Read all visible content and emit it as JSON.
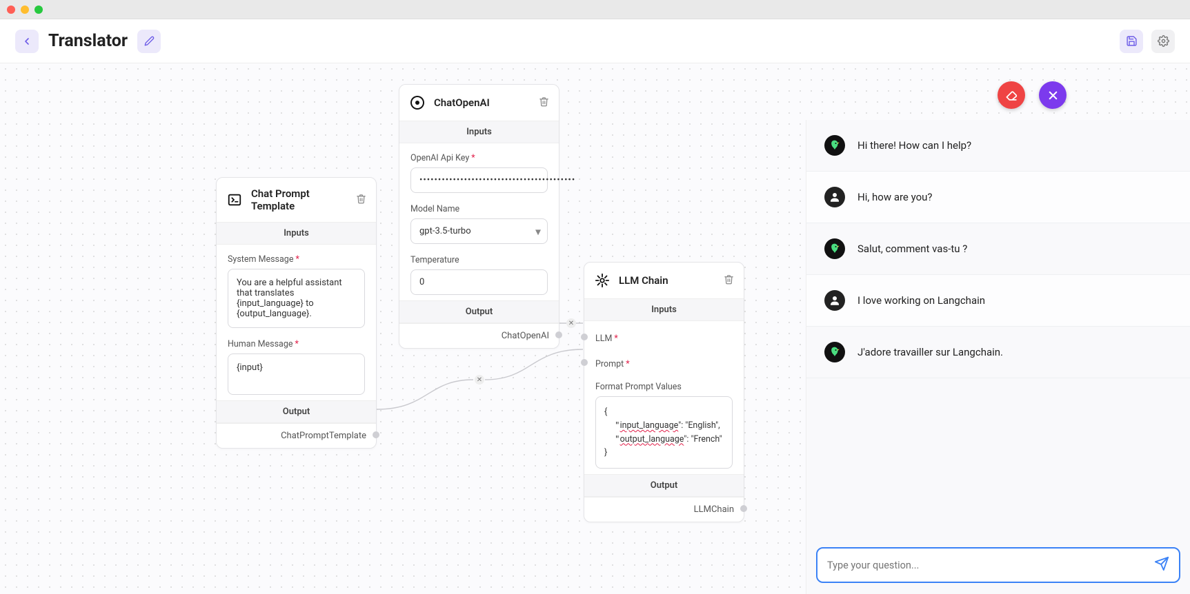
{
  "header": {
    "title": "Translator"
  },
  "nodes": {
    "chat_prompt": {
      "title": "Chat Prompt Template",
      "inputs_header": "Inputs",
      "fields": {
        "system_label": "System Message",
        "system_value": "You are a helpful assistant that translates {input_language} to {output_language}.",
        "human_label": "Human Message",
        "human_value": "{input}"
      },
      "output_header": "Output",
      "output_label": "ChatPromptTemplate"
    },
    "chat_openai": {
      "title": "ChatOpenAI",
      "inputs_header": "Inputs",
      "fields": {
        "apikey_label": "OpenAI Api Key",
        "apikey_value": "••••••••••••••••••••••••••••••••••••••••••",
        "model_label": "Model Name",
        "model_value": "gpt-3.5-turbo",
        "temperature_label": "Temperature",
        "temperature_value": "0"
      },
      "output_header": "Output",
      "output_label": "ChatOpenAI"
    },
    "llm_chain": {
      "title": "LLM Chain",
      "inputs_header": "Inputs",
      "fields": {
        "llm_label": "LLM",
        "prompt_label": "Prompt",
        "format_label": "Format Prompt Values",
        "format_value_l1": "{",
        "format_value_l2k": "input_language",
        "format_value_l2r": "\": \"English\",",
        "format_value_l3k": "output_language",
        "format_value_l3r": "\": \"French\"",
        "format_value_l4": "}"
      },
      "output_header": "Output",
      "output_label": "LLMChain"
    }
  },
  "chat": {
    "messages": [
      {
        "role": "bot",
        "text": "Hi there! How can I help?"
      },
      {
        "role": "user",
        "text": "Hi, how are you?"
      },
      {
        "role": "bot",
        "text": "Salut, comment vas-tu ?"
      },
      {
        "role": "user",
        "text": "I love working on Langchain"
      },
      {
        "role": "bot",
        "text": "J'adore travailler sur Langchain."
      }
    ],
    "input_placeholder": "Type your question..."
  }
}
